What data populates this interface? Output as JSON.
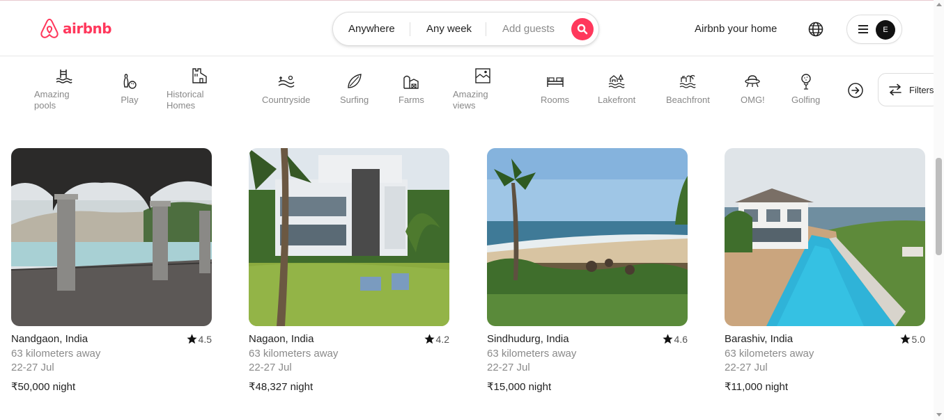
{
  "header": {
    "logo_text": "airbnb",
    "search": {
      "anywhere": "Anywhere",
      "any_week": "Any week",
      "add_guests": "Add guests"
    },
    "host_link": "Airbnb your home",
    "avatar_initial": "E"
  },
  "categories": [
    {
      "label": "Amazing pools",
      "icon": "pool-icon"
    },
    {
      "label": "Play",
      "icon": "bowling-icon"
    },
    {
      "label": "Historical Homes",
      "icon": "historical-home-icon"
    },
    {
      "label": "Countryside",
      "icon": "countryside-icon"
    },
    {
      "label": "Surfing",
      "icon": "surfboard-icon"
    },
    {
      "label": "Farms",
      "icon": "farm-icon"
    },
    {
      "label": "Amazing views",
      "icon": "views-icon"
    },
    {
      "label": "Rooms",
      "icon": "bed-icon"
    },
    {
      "label": "Lakefront",
      "icon": "lakefront-icon"
    },
    {
      "label": "Beachfront",
      "icon": "beachfront-icon"
    },
    {
      "label": "OMG!",
      "icon": "ufo-icon"
    },
    {
      "label": "Golfing",
      "icon": "golf-icon"
    }
  ],
  "filters_label": "Filters",
  "listings": [
    {
      "place": "Nandgaon, India",
      "rating": "4.5",
      "distance": "63 kilometers away",
      "dates": "22-27 Jul",
      "price": "₹50,000 night"
    },
    {
      "place": "Nagaon, India",
      "rating": "4.2",
      "distance": "63 kilometers away",
      "dates": "22-27 Jul",
      "price": "₹48,327 night"
    },
    {
      "place": "Sindhudurg, India",
      "rating": "4.6",
      "distance": "63 kilometers away",
      "dates": "22-27 Jul",
      "price": "₹15,000 night"
    },
    {
      "place": "Barashiv, India",
      "rating": "5.0",
      "distance": "63 kilometers away",
      "dates": "22-27 Jul",
      "price": "₹11,000 night"
    }
  ],
  "colors": {
    "brand": "#ff385c",
    "text": "#222222",
    "muted": "#8a8a8a"
  }
}
